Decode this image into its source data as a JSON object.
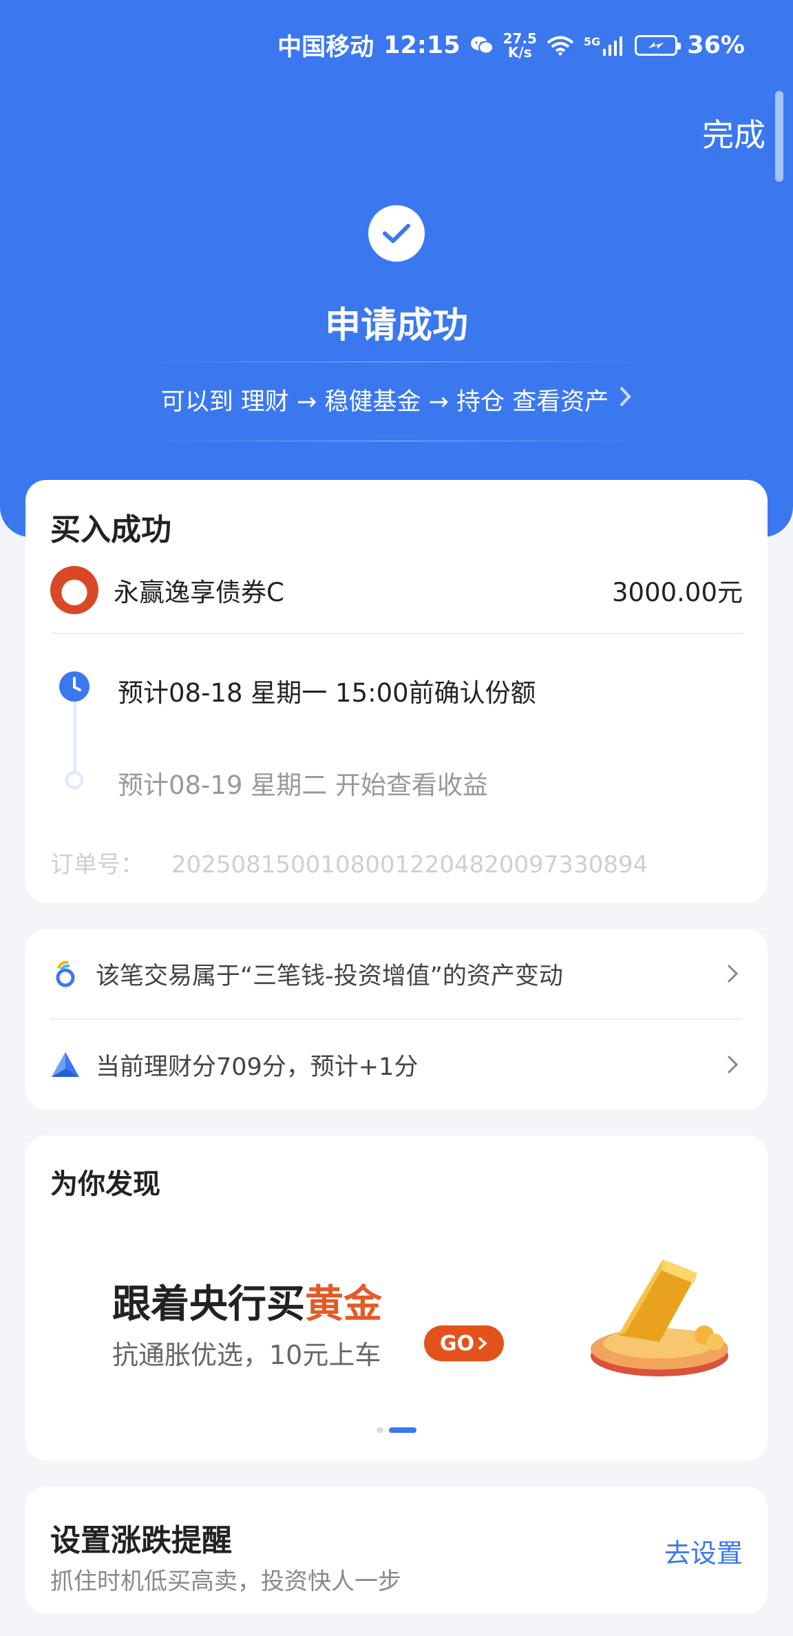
{
  "status_bar": {
    "carrier": "中国移动",
    "time": "12:15",
    "net_speed_value": "27.5",
    "net_speed_unit": "K/s",
    "network_type": "5G",
    "battery_percent": "36%",
    "icons": [
      "wechat-icon",
      "wifi-icon",
      "signal-icon",
      "battery-charging-icon"
    ]
  },
  "header": {
    "done_label": "完成",
    "title": "申请成功",
    "hint": "可以到 理财 → 稳健基金 → 持仓 查看资产"
  },
  "purchase": {
    "title": "买入成功",
    "fund_name": "永赢逸享债券C",
    "amount": "3000.00元",
    "timeline": [
      {
        "text": "预计08-18 星期一 15:00前确认份额",
        "active": true
      },
      {
        "text": "预计08-19 星期二 开始查看收益",
        "active": false
      }
    ],
    "order_label": "订单号：",
    "order_no": "20250815001080012204820097330894"
  },
  "info_links": [
    {
      "icon": "three-money-icon",
      "text": "该笔交易属于“三笔钱-投资增值”的资产变动"
    },
    {
      "icon": "finance-score-icon",
      "text": "当前理财分709分，预计+1分"
    }
  ],
  "discover": {
    "title": "为你发现",
    "banner_head_prefix": "跟着央行买",
    "banner_head_highlight": "黄金",
    "banner_sub": "抗通胀优选，10元上车",
    "banner_button": "GO",
    "carousel_count": 2,
    "carousel_active": 2
  },
  "reminder": {
    "title": "设置涨跌提醒",
    "subtitle": "抓住时机低买高卖，投资快人一步",
    "action": "去设置"
  },
  "colors": {
    "primary": "#3b78f0",
    "accent_gold": "#e45a26",
    "background": "#f4f5f9"
  }
}
